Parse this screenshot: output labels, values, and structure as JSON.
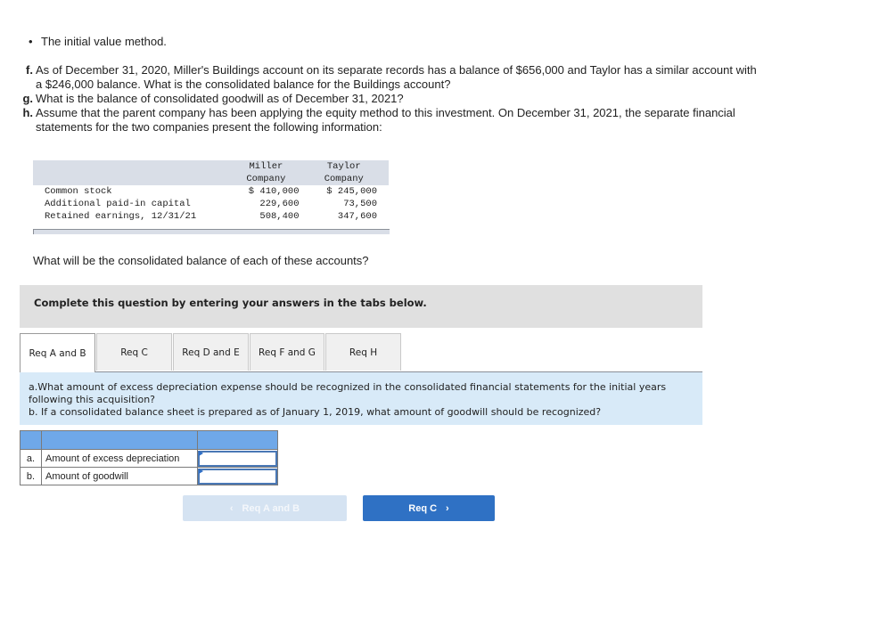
{
  "bullet": {
    "text": "The initial value method."
  },
  "questions": [
    {
      "letter": "f.",
      "text": "As of December 31, 2020, Miller's Buildings account on its separate records has a balance of $656,000 and Taylor has a similar account with a $246,000 balance. What is the consolidated balance for the Buildings account?"
    },
    {
      "letter": "g.",
      "text": "What is the balance of consolidated goodwill as of December 31, 2021?"
    },
    {
      "letter": "h.",
      "text": "Assume that the parent company has been applying the equity method to this investment. On December 31, 2021, the separate financial statements for the two companies present the following information:"
    }
  ],
  "financial_table": {
    "columns": [
      {
        "line1": "Miller",
        "line2": "Company"
      },
      {
        "line1": "Taylor",
        "line2": "Company"
      }
    ],
    "rows": [
      {
        "label": "Common stock",
        "miller": "$ 410,000",
        "taylor": "$ 245,000"
      },
      {
        "label": "Additional paid-in capital",
        "miller": "229,600",
        "taylor": "73,500"
      },
      {
        "label": "Retained earnings, 12/31/21",
        "miller": "508,400",
        "taylor": "347,600"
      }
    ]
  },
  "prompt": "What will be the consolidated balance of each of these accounts?",
  "instruction": "Complete this question by entering your answers in the tabs below.",
  "tabs": [
    {
      "label": "Req A and B",
      "active": true
    },
    {
      "label": "Req C",
      "active": false
    },
    {
      "label": "Req D and E",
      "active": false
    },
    {
      "label": "Req F and G",
      "active": false
    },
    {
      "label": "Req H",
      "active": false
    }
  ],
  "requirement": {
    "line_a": "a.What amount of excess depreciation expense should be recognized in the consolidated financial statements for the initial years following this acquisition?",
    "line_b": "b. If a consolidated balance sheet is prepared as of January 1, 2019, what amount of goodwill should be recognized?"
  },
  "answer_table": {
    "rows": [
      {
        "letter": "a.",
        "label": "Amount of excess depreciation",
        "value": ""
      },
      {
        "letter": "b.",
        "label": "Amount of goodwill",
        "value": ""
      }
    ]
  },
  "nav": {
    "prev_label": "Req A and B",
    "next_label": "Req C",
    "prev_icon": "‹",
    "next_icon": "›"
  }
}
